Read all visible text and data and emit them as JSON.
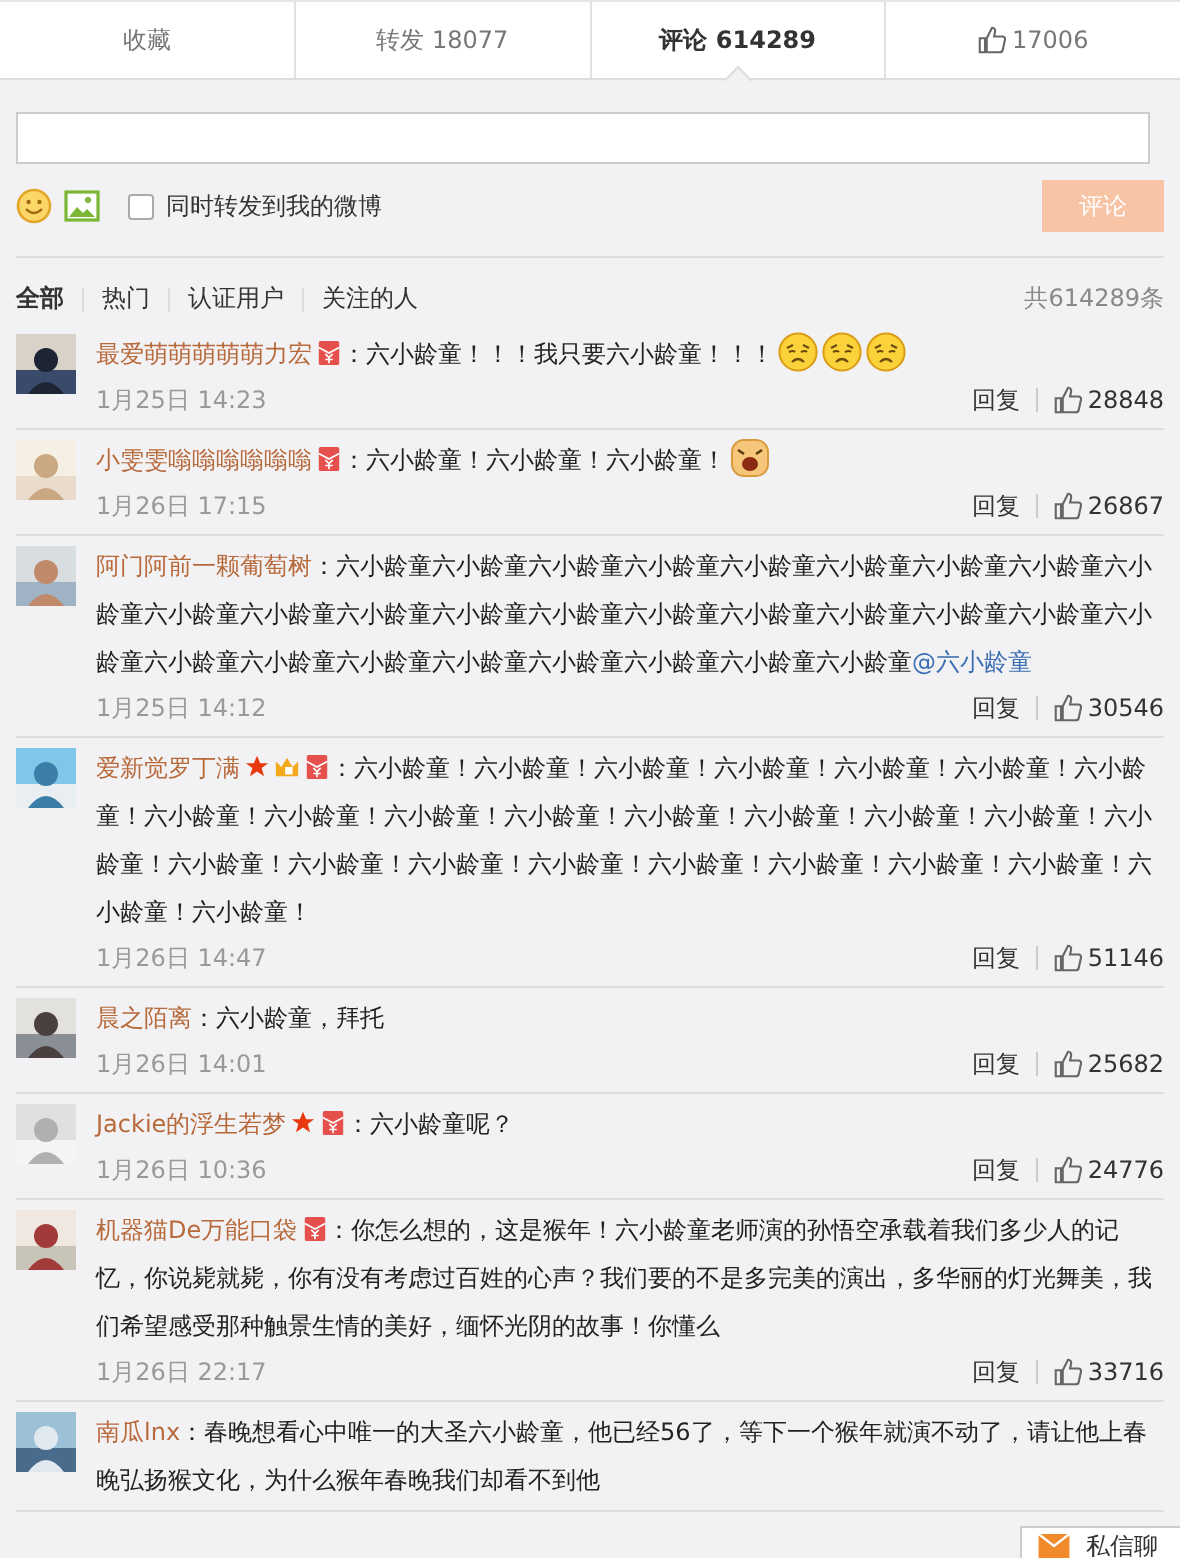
{
  "tabs": [
    {
      "label": "收藏",
      "kind": "text",
      "selected": false
    },
    {
      "label": "转发 18077",
      "kind": "text",
      "selected": false
    },
    {
      "label": "评论 614289",
      "kind": "text",
      "selected": true
    },
    {
      "label": "17006",
      "kind": "likes",
      "selected": false
    }
  ],
  "composer": {
    "forward_label": "同时转发到我的微博",
    "forward_checked": false,
    "submit": "评论",
    "submit_disabled": true
  },
  "filters": [
    {
      "label": "全部",
      "selected": true
    },
    {
      "label": "热门",
      "selected": false
    },
    {
      "label": "认证用户",
      "selected": false
    },
    {
      "label": "关注的人",
      "selected": false
    }
  ],
  "total": "共614289条",
  "comments": [
    {
      "user": "最爱萌萌萌萌萌力宏",
      "badges": [
        {
          "kind": "redpacket"
        }
      ],
      "text": "：六小龄童！！！我只要六小龄童！！！",
      "emoji": [
        {
          "kind": "sad"
        },
        {
          "kind": "sad"
        },
        {
          "kind": "sad"
        }
      ],
      "time": "1月25日 14:23",
      "reply": "回复",
      "likes": "28848"
    },
    {
      "user": "小雯雯嗡嗡嗡嗡嗡嗡",
      "badges": [
        {
          "kind": "redpacket"
        }
      ],
      "text": "：六小龄童！六小龄童！六小龄童！",
      "emoji": [
        {
          "kind": "cry"
        }
      ],
      "time": "1月26日 17:15",
      "reply": "回复",
      "likes": "26867"
    },
    {
      "user": "阿门阿前一颗葡萄树",
      "text": "：六小龄童六小龄童六小龄童六小龄童六小龄童六小龄童六小龄童六小龄童六小龄童六小龄童六小龄童六小龄童六小龄童六小龄童六小龄童六小龄童六小龄童六小龄童六小龄童六小龄童六小龄童六小龄童六小龄童六小龄童六小龄童六小龄童六小龄童六小龄童",
      "mention": "@六小龄童",
      "time": "1月25日 14:12",
      "reply": "回复",
      "likes": "30546"
    },
    {
      "user": "爱新觉罗丁满",
      "badges": [
        {
          "kind": "star"
        },
        {
          "kind": "crown"
        },
        {
          "kind": "redpacket"
        }
      ],
      "text": "：六小龄童！六小龄童！六小龄童！六小龄童！六小龄童！六小龄童！六小龄童！六小龄童！六小龄童！六小龄童！六小龄童！六小龄童！六小龄童！六小龄童！六小龄童！六小龄童！六小龄童！六小龄童！六小龄童！六小龄童！六小龄童！六小龄童！六小龄童！六小龄童！六小龄童！六小龄童！",
      "time": "1月26日 14:47",
      "reply": "回复",
      "likes": "51146"
    },
    {
      "user": "晨之陌离",
      "text": "：六小龄童，拜托",
      "time": "1月26日 14:01",
      "reply": "回复",
      "likes": "25682"
    },
    {
      "user": "Jackie的浮生若梦",
      "badges": [
        {
          "kind": "star"
        },
        {
          "kind": "redpacket"
        }
      ],
      "text": "：六小龄童呢？",
      "time": "1月26日 10:36",
      "reply": "回复",
      "likes": "24776"
    },
    {
      "user": "机器猫De万能口袋",
      "badges": [
        {
          "kind": "redpacket"
        }
      ],
      "text": "：你怎么想的，这是猴年！六小龄童老师演的孙悟空承载着我们多少人的记忆，你说毙就毙，你有没有考虑过百姓的心声？我们要的不是多完美的演出，多华丽的灯光舞美，我们希望感受那种触景生情的美好，缅怀光阴的故事！你懂么",
      "time": "1月26日 22:17",
      "reply": "回复",
      "likes": "33716"
    },
    {
      "user": "南瓜lnx",
      "text": "：春晚想看心中唯一的大圣六小龄童，他已经56了，等下一个猴年就演不动了，请让他上春晚弘扬猴文化，为什么猴年春晚我们却看不到他"
    }
  ],
  "chat_tab": {
    "label": "私信聊"
  }
}
